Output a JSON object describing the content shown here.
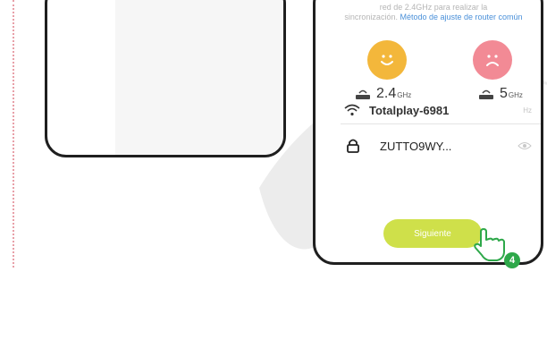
{
  "instructions": {
    "text_line1": "red de 2.4GHz para realizar la",
    "text_line2": "sincronización.",
    "link_text": "Método de ajuste de router común"
  },
  "bands": {
    "band_24_value": "2.4",
    "band_24_unit": "GHz",
    "band_5_value": "5",
    "band_5_unit": "GHz"
  },
  "wifi": {
    "ssid": "Totalplay-6981",
    "band_hint": "Hz",
    "password": "ZUTTO9WY..."
  },
  "next_button": {
    "label": "Siguiente"
  },
  "step": {
    "number": "4"
  },
  "colors": {
    "accent_button": "#cfe04a",
    "happy_face": "#f3b73b",
    "sad_face": "#f28a95",
    "link": "#4a90d9",
    "step_badge": "#2ea84a",
    "dotted_guide": "#e8a0a8"
  },
  "icons": [
    "router-icon",
    "wifi-icon",
    "lock-icon",
    "eye-icon",
    "hand-cursor-icon",
    "happy-face-icon",
    "sad-face-icon"
  ]
}
